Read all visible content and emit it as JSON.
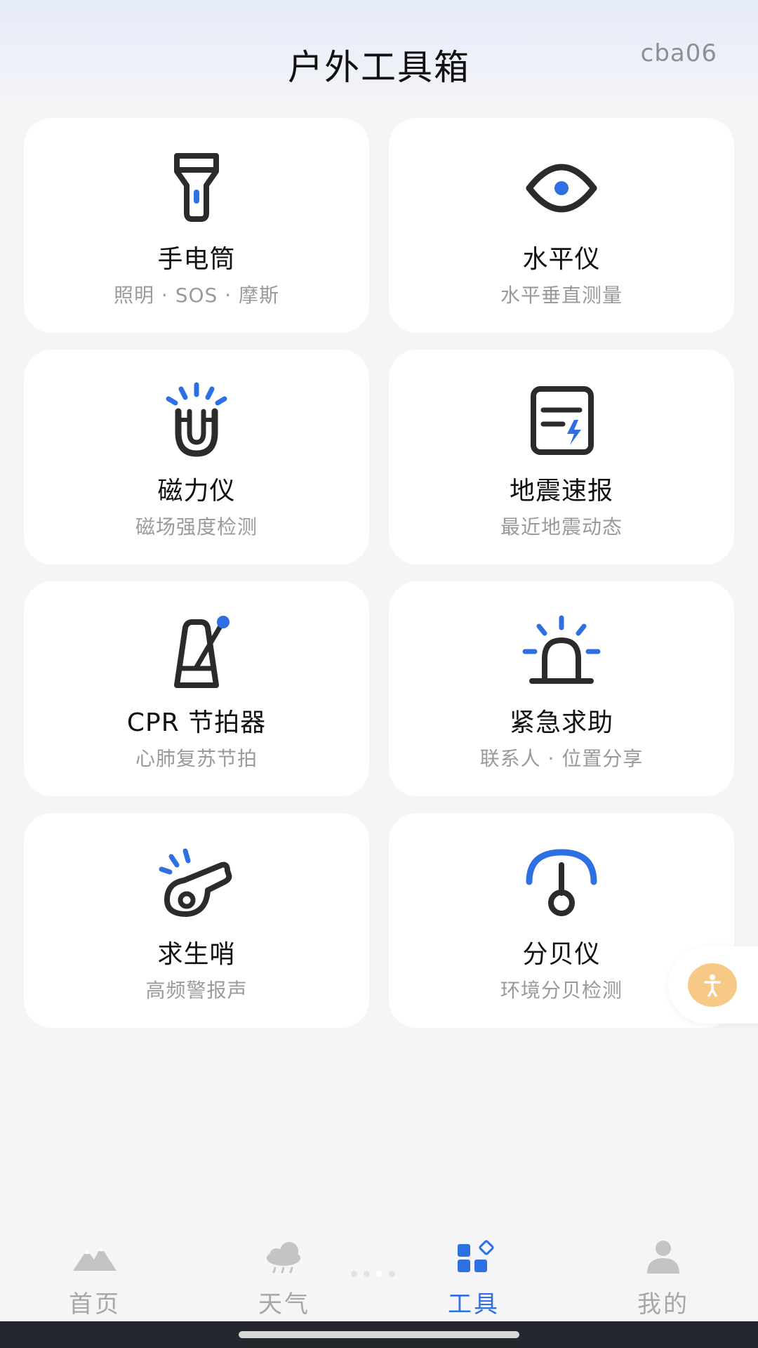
{
  "header": {
    "title": "户外工具箱",
    "user_tag": "cba06"
  },
  "colors": {
    "accent": "#2f6fe4",
    "icon_dark": "#2b2b2b",
    "card_bg": "#ffffff",
    "page_bg": "#f5f5f7",
    "float_button": "#f7c986"
  },
  "tools": [
    {
      "icon": "flashlight-icon",
      "title": "手电筒",
      "subtitle": "照明 · SOS · 摩斯"
    },
    {
      "icon": "level-icon",
      "title": "水平仪",
      "subtitle": "水平垂直测量"
    },
    {
      "icon": "magnet-icon",
      "title": "磁力仪",
      "subtitle": "磁场强度检测"
    },
    {
      "icon": "earthquake-report-icon",
      "title": "地震速报",
      "subtitle": "最近地震动态"
    },
    {
      "icon": "metronome-icon",
      "title": "CPR 节拍器",
      "subtitle": "心肺复苏节拍"
    },
    {
      "icon": "siren-icon",
      "title": "紧急求助",
      "subtitle": "联系人 · 位置分享"
    },
    {
      "icon": "whistle-icon",
      "title": "求生哨",
      "subtitle": "高频警报声"
    },
    {
      "icon": "decibel-meter-icon",
      "title": "分贝仪",
      "subtitle": "环境分贝检测"
    }
  ],
  "floating_button": {
    "icon": "accessibility-icon"
  },
  "tabbar": {
    "active_index": 2,
    "items": [
      {
        "icon": "mountain-icon",
        "label": "首页"
      },
      {
        "icon": "weather-cloud-icon",
        "label": "天气"
      },
      {
        "icon": "tools-grid-icon",
        "label": "工具"
      },
      {
        "icon": "person-icon",
        "label": "我的"
      }
    ]
  }
}
